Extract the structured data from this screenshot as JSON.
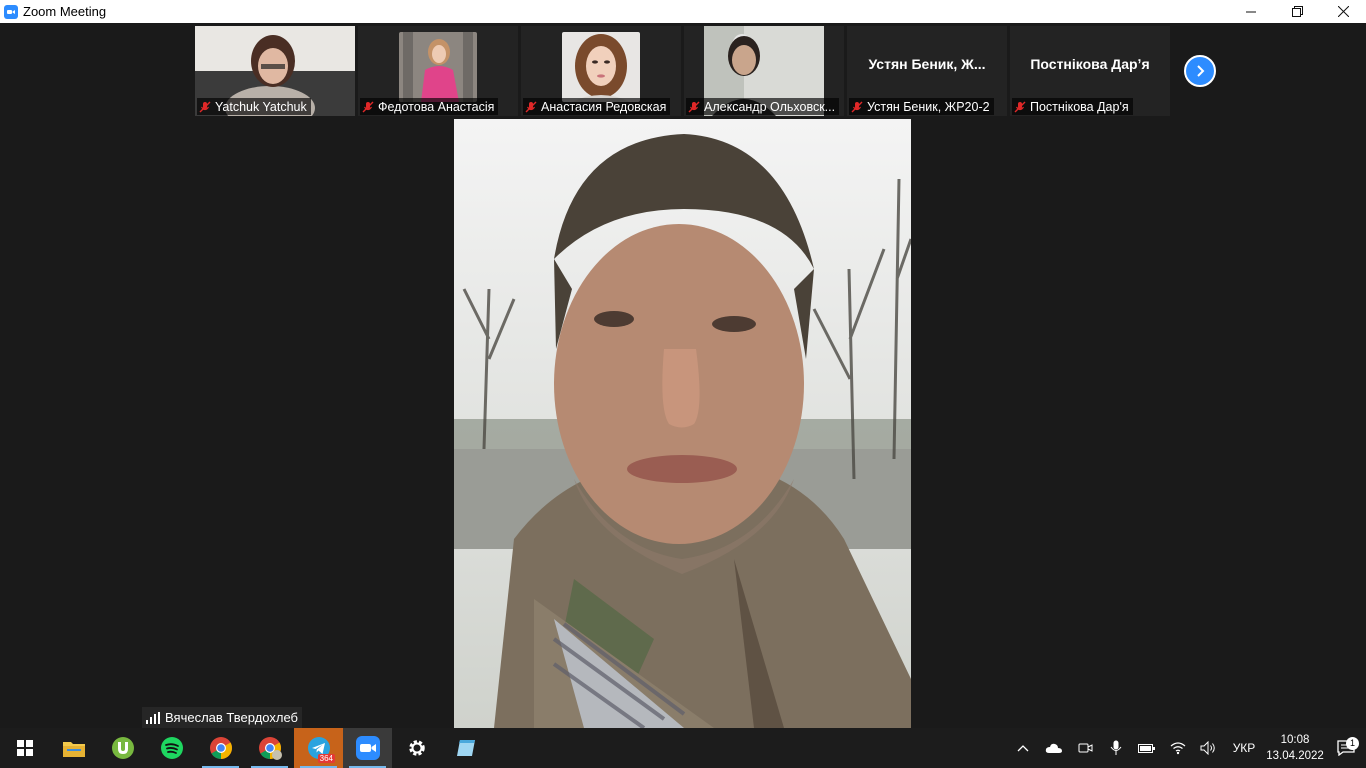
{
  "window": {
    "title": "Zoom Meeting"
  },
  "gallery": {
    "participants": [
      {
        "name": "Yatchuk Yatchuk",
        "muted": true,
        "has_video": true
      },
      {
        "name": "Федотова Анастасія",
        "muted": true,
        "has_video": true
      },
      {
        "name": "Анастасия Редовская",
        "muted": true,
        "has_video": true
      },
      {
        "name": "Александр Ольховск...",
        "muted": true,
        "has_video": true
      },
      {
        "name": "Устян Беник, ЖР20-2",
        "display": "Устян  Беник,  Ж...",
        "muted": true,
        "has_video": false
      },
      {
        "name": "Постнікова Дар'я",
        "display": "Постнікова Дарʼя",
        "muted": true,
        "has_video": false
      }
    ]
  },
  "active_speaker": {
    "name": "Вячеслав Твердохлеб"
  },
  "taskbar": {
    "apps": [
      "start-icon",
      "file-explorer-icon",
      "utorrent-icon",
      "spotify-icon",
      "chrome-icon",
      "chrome-profile-icon",
      "telegram-icon",
      "zoom-icon",
      "settings-icon",
      "notepad-icon"
    ],
    "telegram_badge": "364",
    "language": "УКР",
    "time": "10:08",
    "date": "13.04.2022",
    "notifications": "1"
  },
  "colors": {
    "zoom_blue": "#2d8cff",
    "mute_red": "#e02828",
    "telegram_active": "#c7631a"
  }
}
